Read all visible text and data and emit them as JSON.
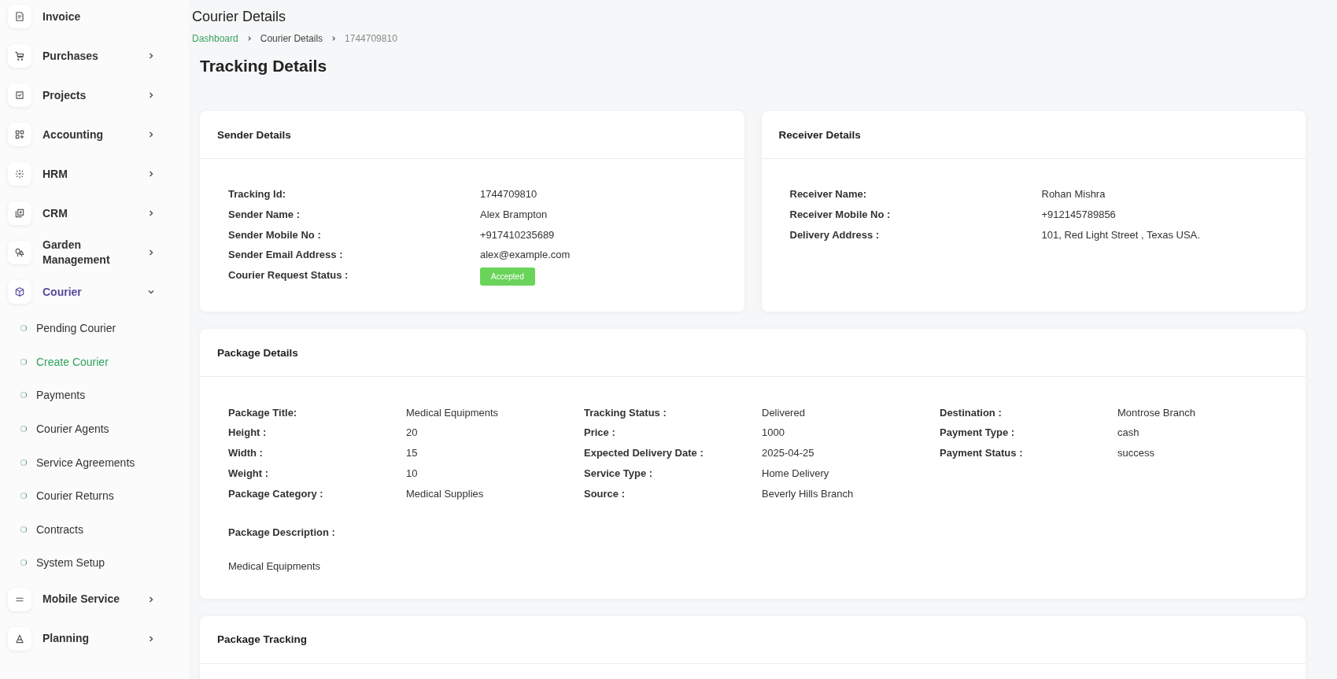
{
  "sidebar": {
    "items": [
      {
        "label": "Invoice",
        "kind": "link",
        "selected": false
      },
      {
        "label": "Purchases",
        "kind": "group",
        "expanded": false,
        "selected": false
      },
      {
        "label": "Projects",
        "kind": "group",
        "expanded": false,
        "selected": false
      },
      {
        "label": "Accounting",
        "kind": "group",
        "expanded": false,
        "selected": false
      },
      {
        "label": "HRM",
        "kind": "group",
        "expanded": false,
        "selected": false
      },
      {
        "label": "CRM",
        "kind": "group",
        "expanded": false,
        "selected": false
      },
      {
        "label": "Garden Management",
        "kind": "group",
        "expanded": false,
        "selected": false
      },
      {
        "label": "Courier",
        "kind": "group",
        "expanded": true,
        "selected": true,
        "children": [
          {
            "label": "Pending Courier",
            "selected": false
          },
          {
            "label": "Create Courier",
            "selected": true
          },
          {
            "label": "Payments",
            "selected": false
          },
          {
            "label": "Courier Agents",
            "selected": false
          },
          {
            "label": "Service Agreements",
            "selected": false
          },
          {
            "label": "Courier Returns",
            "selected": false
          },
          {
            "label": "Contracts",
            "selected": false
          },
          {
            "label": "System Setup",
            "selected": false
          }
        ]
      },
      {
        "label": "Mobile Service",
        "kind": "group",
        "expanded": false,
        "selected": false
      },
      {
        "label": "Planning",
        "kind": "group",
        "expanded": false,
        "selected": false
      }
    ]
  },
  "page": {
    "title": "Courier Details",
    "breadcrumb": [
      "Dashboard",
      "Courier Details",
      "1744709810"
    ],
    "heading": "Tracking Details"
  },
  "sender": {
    "title": "Sender Details",
    "fields": [
      {
        "label": "Tracking Id:",
        "value": "1744709810",
        "kind": "text"
      },
      {
        "label": "Sender Name :",
        "value": "Alex Brampton",
        "kind": "text"
      },
      {
        "label": "Sender Mobile No :",
        "value": "+917410235689",
        "kind": "text"
      },
      {
        "label": "Sender Email Address :",
        "value": "alex@example.com",
        "kind": "text"
      },
      {
        "label": "Courier Request Status :",
        "value": "Accepted",
        "kind": "badge"
      }
    ]
  },
  "receiver": {
    "title": "Receiver Details",
    "fields": [
      {
        "label": "Receiver Name:",
        "value": "Rohan Mishra",
        "kind": "text"
      },
      {
        "label": "Receiver Mobile No :",
        "value": "+912145789856",
        "kind": "text"
      },
      {
        "label": "Delivery Address :",
        "value": "101, Red Light Street , Texas USA.",
        "kind": "text"
      }
    ]
  },
  "package": {
    "title": "Package Details",
    "columns": [
      [
        {
          "label": "Package Title:",
          "value": "Medical Equipments"
        },
        {
          "label": "Height :",
          "value": "20"
        },
        {
          "label": "Width :",
          "value": "15"
        },
        {
          "label": "Weight :",
          "value": "10"
        },
        {
          "label": "Package Category :",
          "value": "Medical Supplies"
        }
      ],
      [
        {
          "label": "Tracking Status :",
          "value": "Delivered"
        },
        {
          "label": "Price :",
          "value": "1000"
        },
        {
          "label": "Expected Delivery Date :",
          "value": "2025-04-25"
        },
        {
          "label": "Service Type :",
          "value": "Home Delivery"
        },
        {
          "label": "Source :",
          "value": "Beverly Hills Branch"
        }
      ],
      [
        {
          "label": "Destination :",
          "value": "Montrose Branch"
        },
        {
          "label": "Payment Type :",
          "value": "cash"
        },
        {
          "label": "Payment Status :",
          "value": "success"
        }
      ]
    ],
    "description_label": "Package Description :",
    "description": "Medical Equipments"
  },
  "tracking": {
    "title": "Package Tracking"
  }
}
